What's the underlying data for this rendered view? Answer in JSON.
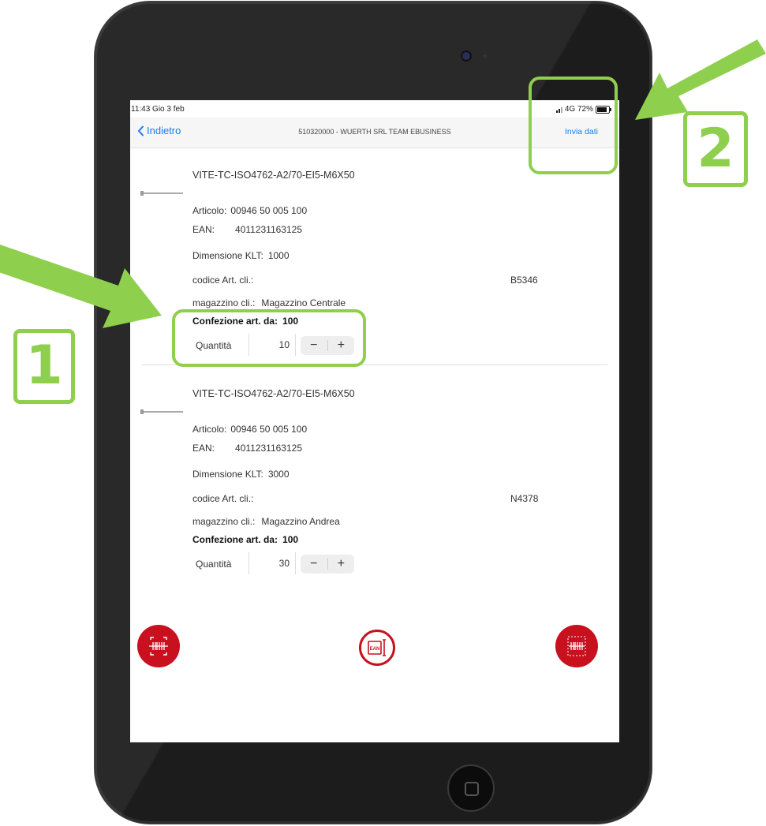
{
  "status_bar": {
    "time": "11:43  Gio 3 feb",
    "network": "4G 72%",
    "battery_percent": 72
  },
  "nav": {
    "back_label": "Indietro",
    "title": "510320000 - WUERTH SRL TEAM EBUSINESS",
    "action_label": "Invia dati"
  },
  "field_labels": {
    "article": "Articolo:",
    "ean": "EAN:",
    "dimension": "Dimensione KLT:",
    "customer_code": "codice Art. cli.:",
    "customer_warehouse": "magazzino cli.:",
    "pack": "Confezione art. da:",
    "quantity": "Quantità"
  },
  "items": [
    {
      "name": "VITE-TC-ISO4762-A2/70-EI5-M6X50",
      "article": "00946  50 005  100",
      "ean": "4011231163125",
      "dimension": "1000",
      "customer_code": "B5346",
      "warehouse": "Magazzino Centrale",
      "pack": "100",
      "quantity": "10"
    },
    {
      "name": "VITE-TC-ISO4762-A2/70-EI5-M6X50",
      "article": "00946  50 005  100",
      "ean": "4011231163125",
      "dimension": "3000",
      "customer_code": "N4378",
      "warehouse": "Magazzino Andrea",
      "pack": "100",
      "quantity": "30"
    }
  ],
  "stepper": {
    "minus": "−",
    "plus": "+"
  },
  "bottom_bar": {
    "center_button_text": "EAN",
    "left_icon": "barcode-scan-icon",
    "right_icon": "barcode-frame-icon"
  },
  "annotations": {
    "badge_1": "1",
    "badge_2": "2"
  },
  "colors": {
    "accent_blue": "#1a7cf0",
    "brand_red": "#c8101e",
    "annotation_green": "#8fcf4e"
  }
}
